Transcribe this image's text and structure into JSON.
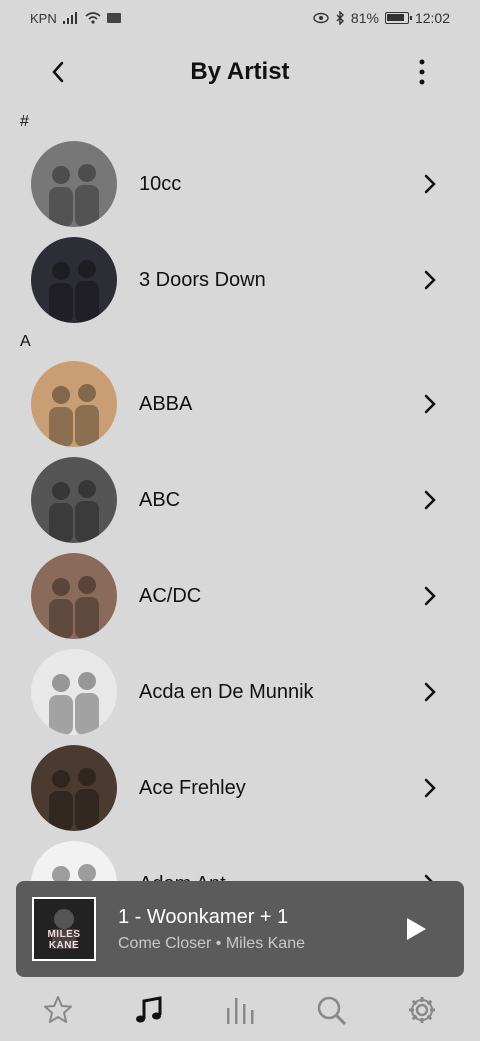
{
  "status": {
    "carrier": "KPN",
    "battery_pct": "81%",
    "time": "12:02"
  },
  "header": {
    "title": "By Artist"
  },
  "sections": [
    {
      "header": "#",
      "items": [
        {
          "label": "10cc",
          "color": "#777777"
        },
        {
          "label": "3 Doors Down",
          "color": "#2d2d35"
        }
      ]
    },
    {
      "header": "A",
      "items": [
        {
          "label": "ABBA",
          "color": "#c99e74"
        },
        {
          "label": "ABC",
          "color": "#555555"
        },
        {
          "label": "AC/DC",
          "color": "#8a6a5a"
        },
        {
          "label": "Acda en De Munnik",
          "color": "#e8e8e8"
        },
        {
          "label": "Ace Frehley",
          "color": "#4a3a30"
        },
        {
          "label": "Adam Ant",
          "color": "#f2f2f2"
        }
      ]
    }
  ],
  "mini_player": {
    "title": "1 - Woonkamer + 1",
    "subtitle": "Come Closer • Miles Kane",
    "art_text": "MILES KANE"
  },
  "bottom_nav": [
    {
      "name": "favorites",
      "icon": "star-icon"
    },
    {
      "name": "music",
      "icon": "music-note-icon"
    },
    {
      "name": "rooms",
      "icon": "equalizer-icon"
    },
    {
      "name": "search",
      "icon": "search-icon"
    },
    {
      "name": "settings",
      "icon": "gear-icon"
    }
  ]
}
